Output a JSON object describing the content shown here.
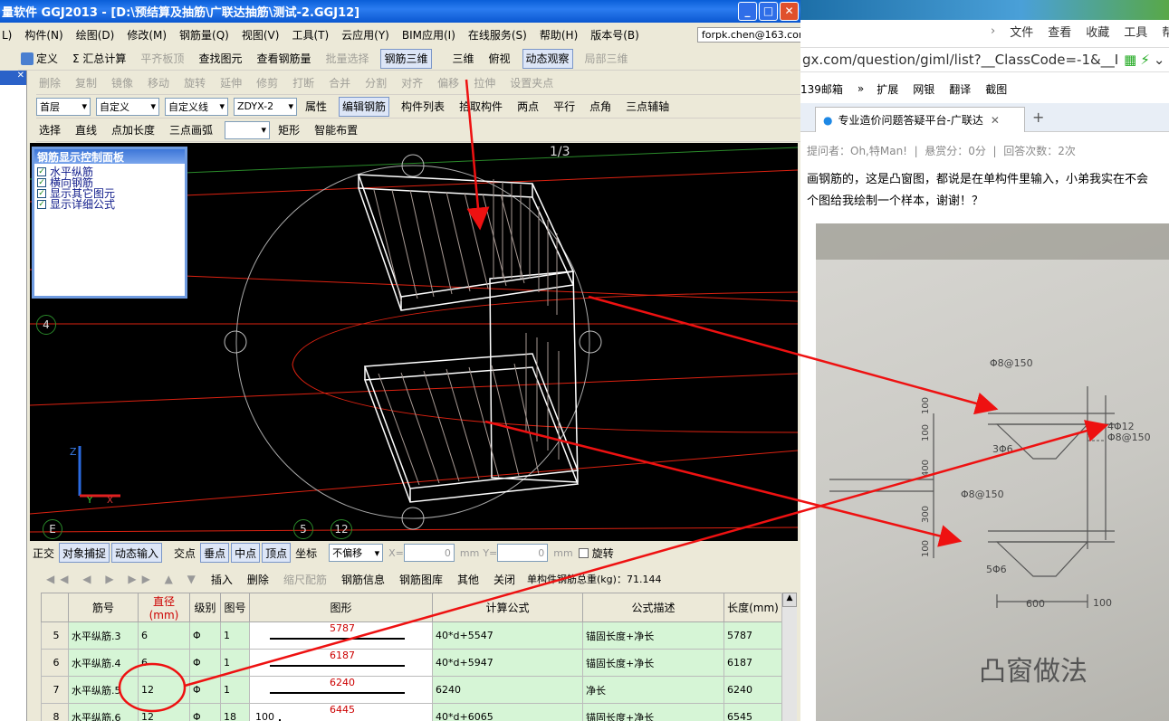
{
  "app": {
    "title": "量软件 GGJ2013 - [D:\\预结算及抽筋\\广联达抽筋\\测试-2.GGJ12]",
    "window_buttons": [
      "_",
      "□",
      "✕"
    ],
    "menu": [
      "L)",
      "构件(N)",
      "绘图(D)",
      "修改(M)",
      "钢筋量(Q)",
      "视图(V)",
      "工具(T)",
      "云应用(Y)",
      "BIM应用(I)",
      "在线服务(S)",
      "帮助(H)",
      "版本号(B)"
    ],
    "account": "forpk.chen@163.com",
    "toolbar1": [
      "定义",
      "Σ 汇总计算",
      "平齐板顶",
      "查找图元",
      "查看钢筋量",
      "批量选择",
      "钢筋三维"
    ],
    "toolbar1_right": [
      "三维",
      "俯视",
      "动态观察",
      "局部三维"
    ],
    "toolbar2": [
      "删除",
      "复制",
      "镜像",
      "移动",
      "旋转",
      "延伸",
      "修剪",
      "打断",
      "合并",
      "分割",
      "对齐",
      "偏移",
      "拉伸",
      "设置夹点"
    ],
    "toolbar3": {
      "floor": "首层",
      "type": "自定义",
      "subtype": "自定义线",
      "element": "ZDYX-2",
      "buttons": [
        "属性",
        "编辑钢筋",
        "构件列表",
        "拾取构件",
        "两点",
        "平行",
        "点角",
        "三点辅轴"
      ]
    },
    "toolbar4": [
      "选择",
      "直线",
      "点加长度",
      "三点画弧",
      "矩形",
      "智能布置"
    ],
    "viewport": {
      "panel_title": "钢筋显示控制面板",
      "checks": [
        "水平纵筋",
        "横向钢筋",
        "显示其它图元",
        "显示详细公式"
      ],
      "page_label": "1/3",
      "axis_labels": [
        "4",
        "E",
        "5",
        "12"
      ],
      "bg_color": "#000000"
    },
    "snapbar": {
      "items": [
        "正交",
        "对象捕捉",
        "动态输入",
        "交点",
        "垂点",
        "中点",
        "顶点",
        "坐标"
      ],
      "offset_mode": "不偏移",
      "x_label": "X=",
      "x_value": "0",
      "y_label": "Y=",
      "y_value": "0",
      "unit": "mm",
      "rotate": "旋转"
    },
    "gridbar": {
      "items": [
        "插入",
        "删除",
        "缩尺配筋",
        "钢筋信息",
        "钢筋图库",
        "其他",
        "关闭"
      ],
      "total": "单构件钢筋总重(kg)：71.144"
    },
    "grid": {
      "headers": [
        "",
        "筋号",
        "直径(mm)",
        "级别",
        "图号",
        "图形",
        "计算公式",
        "公式描述",
        "长度(mm)"
      ],
      "rows": [
        {
          "n": "5",
          "name": "水平纵筋.3",
          "d": "6",
          "lvl": "Φ",
          "fig": "1",
          "shape_left": "",
          "shape_val": "5787",
          "formula": "40*d+5547",
          "desc": "锚固长度+净长",
          "len": "5787"
        },
        {
          "n": "6",
          "name": "水平纵筋.4",
          "d": "6",
          "lvl": "Φ",
          "fig": "1",
          "shape_left": "",
          "shape_val": "6187",
          "formula": "40*d+5947",
          "desc": "锚固长度+净长",
          "len": "6187"
        },
        {
          "n": "7",
          "name": "水平纵筋.5",
          "d": "12",
          "lvl": "Φ",
          "fig": "1",
          "shape_left": "",
          "shape_val": "6240",
          "formula": "6240",
          "desc": "净长",
          "len": "6240"
        },
        {
          "n": "8",
          "name": "水平纵筋.6",
          "d": "12",
          "lvl": "Φ",
          "fig": "18",
          "shape_left": "100",
          "shape_val": "6445",
          "formula": "40*d+6065",
          "desc": "锚固长度+净长",
          "len": "6545"
        }
      ]
    }
  },
  "browser": {
    "menu": [
      "文件",
      "查看",
      "收藏",
      "工具",
      "帮"
    ],
    "url": "gx.com/question/giml/list?__ClassCode=-1&__I",
    "favorites": [
      "139邮箱",
      "扩展",
      "网银",
      "翻译",
      "截图"
    ],
    "tab_title": "专业造价问题答疑平台-广联达",
    "question_meta": "提问者：Oh,特Man!  |  悬赏分：0分  |  回答次数：2次",
    "question_line1": "画钢筋的，这是凸窗图，都说是在单构件里输入，小弟我实在不会",
    "question_line2": "个图给我绘制一个样本，谢谢！？",
    "photo": {
      "labels": [
        "Φ8@150",
        "100",
        "100",
        "3Φ6",
        "400",
        "Φ8@150",
        "300",
        "100",
        "5Φ6",
        "600",
        "100",
        "4Φ12",
        "Φ8@150",
        "凸窗做法"
      ]
    }
  },
  "annotation_color": "#ee1111"
}
